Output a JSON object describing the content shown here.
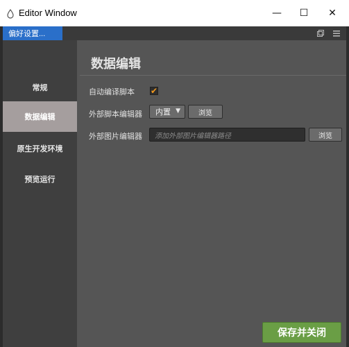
{
  "window": {
    "title": "Editor Window",
    "minimize_glyph": "—",
    "maximize_glyph": "☐",
    "close_glyph": "✕"
  },
  "tabbar": {
    "tab_label": "偏好设置...",
    "popout_icon": "popout-icon",
    "menu_icon": "menu-icon"
  },
  "sidebar": {
    "items": [
      {
        "label": "常规",
        "active": false
      },
      {
        "label": "数据编辑",
        "active": true
      },
      {
        "label": "原生开发环境",
        "active": false
      },
      {
        "label": "预览运行",
        "active": false
      }
    ]
  },
  "main": {
    "title": "数据编辑",
    "auto_compile_label": "自动编译脚本",
    "auto_compile_checked": true,
    "script_editor_label": "外部脚本编辑器",
    "script_editor_value": "内置",
    "browse_label": "浏览",
    "image_editor_label": "外部图片编辑器",
    "image_editor_placeholder": "添加外部图片编辑器路径",
    "browse_label_2": "浏览"
  },
  "footer": {
    "save_label": "保存并关闭"
  },
  "colors": {
    "accent_tab": "#2a6fc9",
    "checkbox_check": "#f39a1e",
    "save_button": "#6a9e45",
    "active_sidebar": "#a59e9e"
  }
}
